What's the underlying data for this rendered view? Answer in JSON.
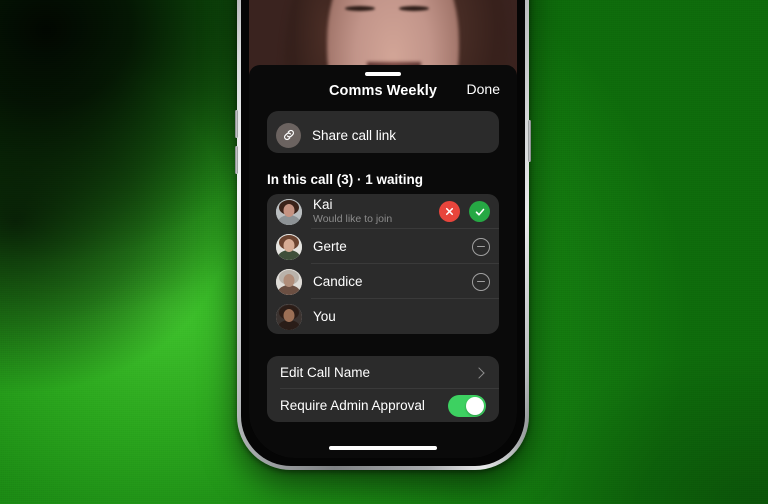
{
  "background": {
    "accent_green": "#1f8a16",
    "bright_green": "#3fc22c",
    "dark_corner": "#000000"
  },
  "phone": {
    "frame_color": "#b9bcbe",
    "home_indicator": "home-indicator"
  },
  "video": {
    "description": "video-feed-participant"
  },
  "sheet": {
    "grabber": "sheet-grabber",
    "title": "Comms Weekly",
    "done_label": "Done",
    "share": {
      "icon": "link-icon",
      "label": "Share call link",
      "icon_bg": "#6b6360"
    },
    "section_header": "In this call (3) · 1 waiting",
    "participants": [
      {
        "name": "Kai",
        "subtitle": "Would like to join",
        "state": "waiting",
        "actions": [
          "decline",
          "accept"
        ],
        "avatar": {
          "bg": "#b9bdbf",
          "hair": "#3a2219",
          "skin": "#c59382",
          "body": "#8d9295"
        }
      },
      {
        "name": "Gerte",
        "subtitle": "",
        "state": "in-call",
        "actions": [
          "remove"
        ],
        "avatar": {
          "bg": "#e4e3df",
          "hair": "#6b4430",
          "skin": "#d6ac94",
          "body": "#3f4f3a"
        }
      },
      {
        "name": "Candice",
        "subtitle": "",
        "state": "in-call",
        "actions": [
          "remove"
        ],
        "avatar": {
          "bg": "#dedbd6",
          "hair": "#b9b2aa",
          "skin": "#b08d79",
          "body": "#6b4f42"
        }
      },
      {
        "name": "You",
        "subtitle": "",
        "state": "in-call",
        "actions": [],
        "avatar": {
          "bg": "#3b3330",
          "hair": "#2c1d17",
          "skin": "#9c6f55",
          "body": "#2a1d18"
        }
      }
    ],
    "settings": [
      {
        "label": "Edit Call Name",
        "control": "chevron"
      },
      {
        "label": "Require Admin Approval",
        "control": "toggle",
        "toggle_on": true,
        "toggle_color": "#3dd161"
      }
    ]
  },
  "colors": {
    "decline_red": "#e8453c",
    "accept_green": "#26a844",
    "card_bg": "#2b2b2b",
    "sheet_bg": "#0a0a0a"
  }
}
